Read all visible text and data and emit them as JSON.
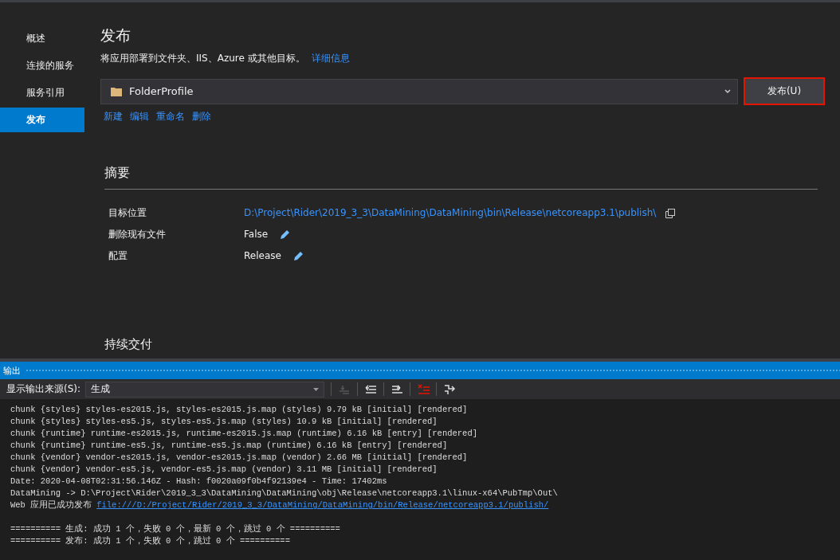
{
  "sidebar": {
    "items": [
      {
        "label": "概述",
        "selected": false
      },
      {
        "label": "连接的服务",
        "selected": false
      },
      {
        "label": "服务引用",
        "selected": false
      },
      {
        "label": "发布",
        "selected": true
      }
    ]
  },
  "publish": {
    "title": "发布",
    "description": "将应用部署到文件夹、IIS、Azure 或其他目标。",
    "details_link": "详细信息",
    "profile": {
      "value": "FolderProfile"
    },
    "publish_button": "发布(U)",
    "profile_actions": [
      "新建",
      "编辑",
      "重命名",
      "删除"
    ]
  },
  "summary": {
    "title": "摘要",
    "rows": [
      {
        "kind": "path",
        "label": "目标位置",
        "value": "D:\\Project\\Rider\\2019_3_3\\DataMining\\DataMining\\bin\\Release\\netcoreapp3.1\\publish\\"
      },
      {
        "kind": "editable",
        "label": "删除现有文件",
        "value": "False"
      },
      {
        "kind": "editable",
        "label": "配置",
        "value": "Release"
      }
    ]
  },
  "next_section": {
    "title": "持续交付"
  },
  "output": {
    "title": "输出",
    "source_label": "显示输出来源(S):",
    "source": "生成",
    "tools": [
      {
        "kind": "goto",
        "disabled": true
      },
      {
        "kind": "prev",
        "disabled": false
      },
      {
        "kind": "next",
        "disabled": false
      },
      {
        "kind": "clear",
        "disabled": false
      },
      {
        "kind": "wrap",
        "disabled": false
      }
    ],
    "lines": [
      {
        "text": "chunk {styles} styles-es2015.js, styles-es2015.js.map (styles) 9.79 kB [initial] [rendered]"
      },
      {
        "text": "chunk {styles} styles-es5.js, styles-es5.js.map (styles) 10.9 kB [initial] [rendered]"
      },
      {
        "text": "chunk {runtime} runtime-es2015.js, runtime-es2015.js.map (runtime) 6.16 kB [entry] [rendered]"
      },
      {
        "text": "chunk {runtime} runtime-es5.js, runtime-es5.js.map (runtime) 6.16 kB [entry] [rendered]"
      },
      {
        "text": "chunk {vendor} vendor-es2015.js, vendor-es2015.js.map (vendor) 2.66 MB [initial] [rendered]"
      },
      {
        "text": "chunk {vendor} vendor-es5.js, vendor-es5.js.map (vendor) 3.11 MB [initial] [rendered]"
      },
      {
        "text": "Date: 2020-04-08T02:31:56.146Z - Hash: f0020a09f0b4f92139e4 - Time: 17402ms"
      },
      {
        "text": "DataMining -> D:\\Project\\Rider\\2019_3_3\\DataMining\\DataMining\\obj\\Release\\netcoreapp3.1\\linux-x64\\PubTmp\\Out\\"
      },
      {
        "text": "Web 应用已成功发布",
        "link": "file:///D:/Project/Rider/2019_3_3/DataMining/DataMining/bin/Release/netcoreapp3.1/publish/"
      }
    ],
    "summary_lines": [
      {
        "text": "========== 生成: 成功 1 个，失败 0 个，最新 0 个，跳过 0 个 =========="
      },
      {
        "text": "========== 发布: 成功 1 个，失败 0 个，跳过 0 个 =========="
      }
    ]
  }
}
